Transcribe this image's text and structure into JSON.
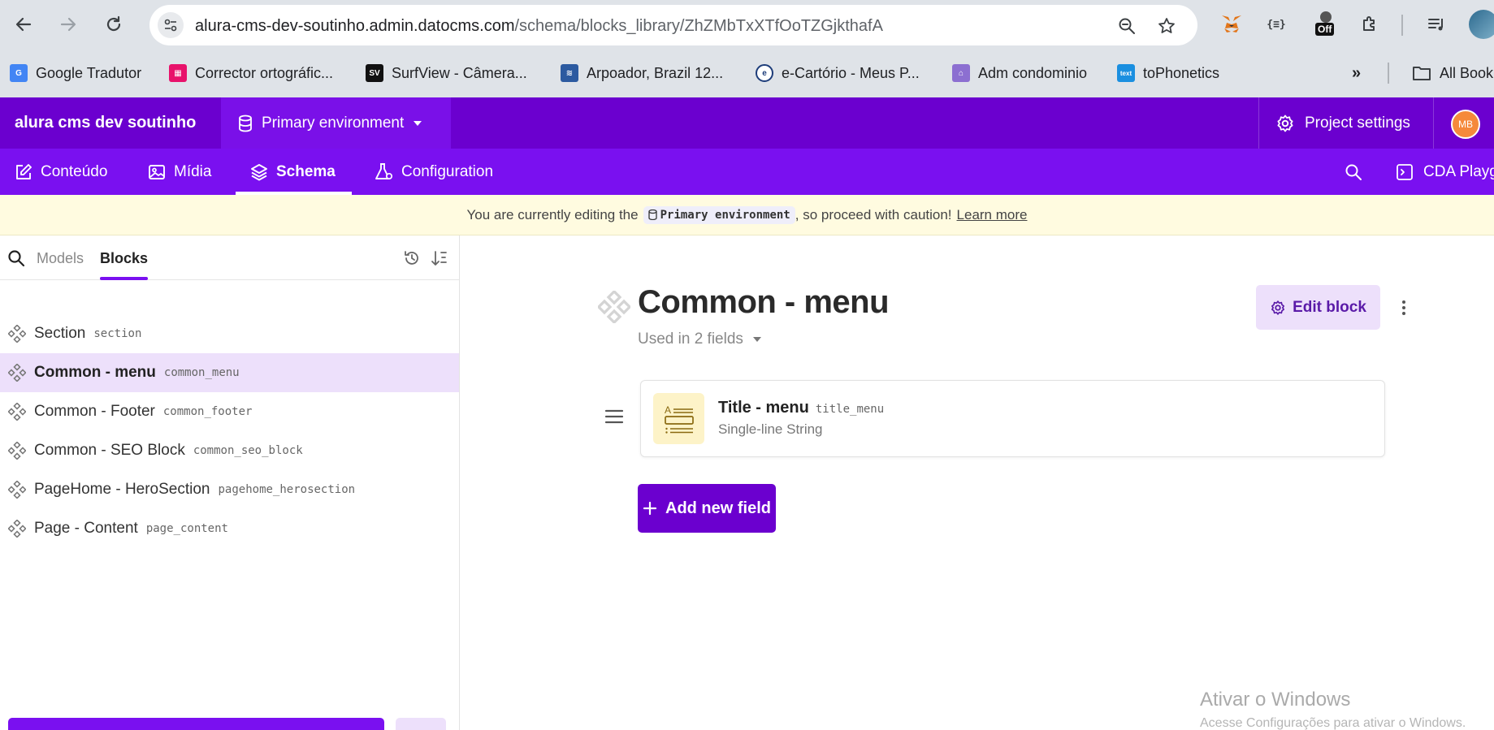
{
  "browser": {
    "url_host": "alura-cms-dev-soutinho.admin.datocms.com",
    "url_path": "/schema/blocks_library/ZhZMbTxXTfOoTZGjkthafA",
    "extension_badge": "Off",
    "bookmarks": [
      {
        "label": "Google Tradutor",
        "icon": "google-translate-icon",
        "color": "#4285f4"
      },
      {
        "label": "Corrector ortográfic...",
        "icon": "corrector-icon",
        "color": "#e8126b"
      },
      {
        "label": "SurfView - Câmera...",
        "icon": "surfview-icon",
        "color": "#111111"
      },
      {
        "label": "Arpoador, Brazil 12...",
        "icon": "arpoador-icon",
        "color": "#2c5aa0"
      },
      {
        "label": "e-Cartório - Meus P...",
        "icon": "ecartorio-icon",
        "color": "#1e3d7a"
      },
      {
        "label": "Adm condominio",
        "icon": "condominio-icon",
        "color": "#8c6fd1"
      },
      {
        "label": "toPhonetics",
        "icon": "tophonetics-icon",
        "color": "#1a8fe0"
      }
    ],
    "all_bookmarks": "All Book"
  },
  "app": {
    "project_name": "alura cms dev soutinho",
    "environment_label": "Primary environment",
    "project_settings": "Project settings",
    "user_initials": "MB",
    "nav_tabs": [
      {
        "label": "Conteúdo",
        "icon": "edit-icon"
      },
      {
        "label": "Mídia",
        "icon": "image-icon"
      },
      {
        "label": "Schema",
        "icon": "layers-icon",
        "active": true
      },
      {
        "label": "Configuration",
        "icon": "flask-icon"
      }
    ],
    "cda_playground": "CDA Playg"
  },
  "banner": {
    "prefix": "You are currently editing the",
    "env_chip": "Primary environment",
    "suffix": ", so proceed with caution!",
    "link": "Learn more"
  },
  "sidebar": {
    "tabs": [
      "Models",
      "Blocks"
    ],
    "active_tab": "Blocks",
    "items": [
      {
        "name": "Section",
        "api": "section"
      },
      {
        "name": "Common - menu",
        "api": "common_menu",
        "selected": true
      },
      {
        "name": "Common - Footer",
        "api": "common_footer"
      },
      {
        "name": "Common - SEO Block",
        "api": "common_seo_block"
      },
      {
        "name": "PageHome - HeroSection",
        "api": "pagehome_herosection"
      },
      {
        "name": "Page - Content",
        "api": "page_content"
      }
    ]
  },
  "main": {
    "title": "Common - menu",
    "used_in": "Used in 2 fields",
    "edit_button": "Edit block",
    "fields": [
      {
        "name": "Title - menu",
        "api": "title_menu",
        "type": "Single-line String"
      }
    ],
    "add_field_button": "Add new field"
  },
  "watermark": {
    "title": "Ativar o Windows",
    "subtitle": "Acesse Configurações para ativar o Windows."
  },
  "colors": {
    "header": "#6b00cf",
    "nav": "#7a10f0",
    "accent_light": "#ede0fb",
    "banner": "#fffbe0"
  }
}
